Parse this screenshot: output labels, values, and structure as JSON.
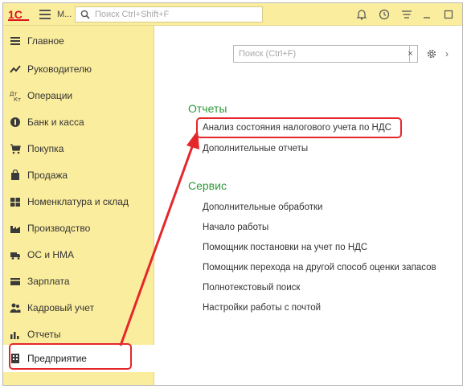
{
  "titlebar": {
    "app_short": "М...",
    "search_placeholder": "Поиск Ctrl+Shift+F"
  },
  "sidebar": {
    "items": [
      {
        "label": "Главное",
        "icon": "menu-lines-icon"
      },
      {
        "label": "Руководителю",
        "icon": "trend-chart-icon"
      },
      {
        "label": "Операции",
        "icon": "debit-credit-icon"
      },
      {
        "label": "Банк и касса",
        "icon": "coins-icon"
      },
      {
        "label": "Покупка",
        "icon": "cart-icon"
      },
      {
        "label": "Продажа",
        "icon": "bag-icon"
      },
      {
        "label": "Номенклатура и склад",
        "icon": "warehouse-icon"
      },
      {
        "label": "Производство",
        "icon": "factory-icon"
      },
      {
        "label": "ОС и НМА",
        "icon": "truck-icon"
      },
      {
        "label": "Зарплата",
        "icon": "wallet-icon"
      },
      {
        "label": "Кадровый учет",
        "icon": "people-icon"
      },
      {
        "label": "Отчеты",
        "icon": "bar-chart-icon"
      },
      {
        "label": "Предприятие",
        "icon": "building-icon",
        "active": true
      }
    ]
  },
  "main": {
    "search_placeholder": "Поиск (Ctrl+F)",
    "clear_label": "×",
    "more_label": "›",
    "sections": [
      {
        "title": "Отчеты",
        "links": [
          "Анализ состояния налогового учета по НДС",
          "Дополнительные отчеты"
        ]
      },
      {
        "title": "Сервис",
        "links": [
          "Дополнительные обработки",
          "Начало работы",
          "Помощник постановки на учет по НДС",
          "Помощник перехода на другой способ оценки запасов",
          "Полнотекстовый поиск",
          "Настройки работы с почтой"
        ]
      }
    ]
  },
  "colors": {
    "panel_bg": "#fbed9e",
    "section_green": "#2e9b3a",
    "annotation_red": "#e5272b",
    "logo_red": "#d9161b"
  }
}
